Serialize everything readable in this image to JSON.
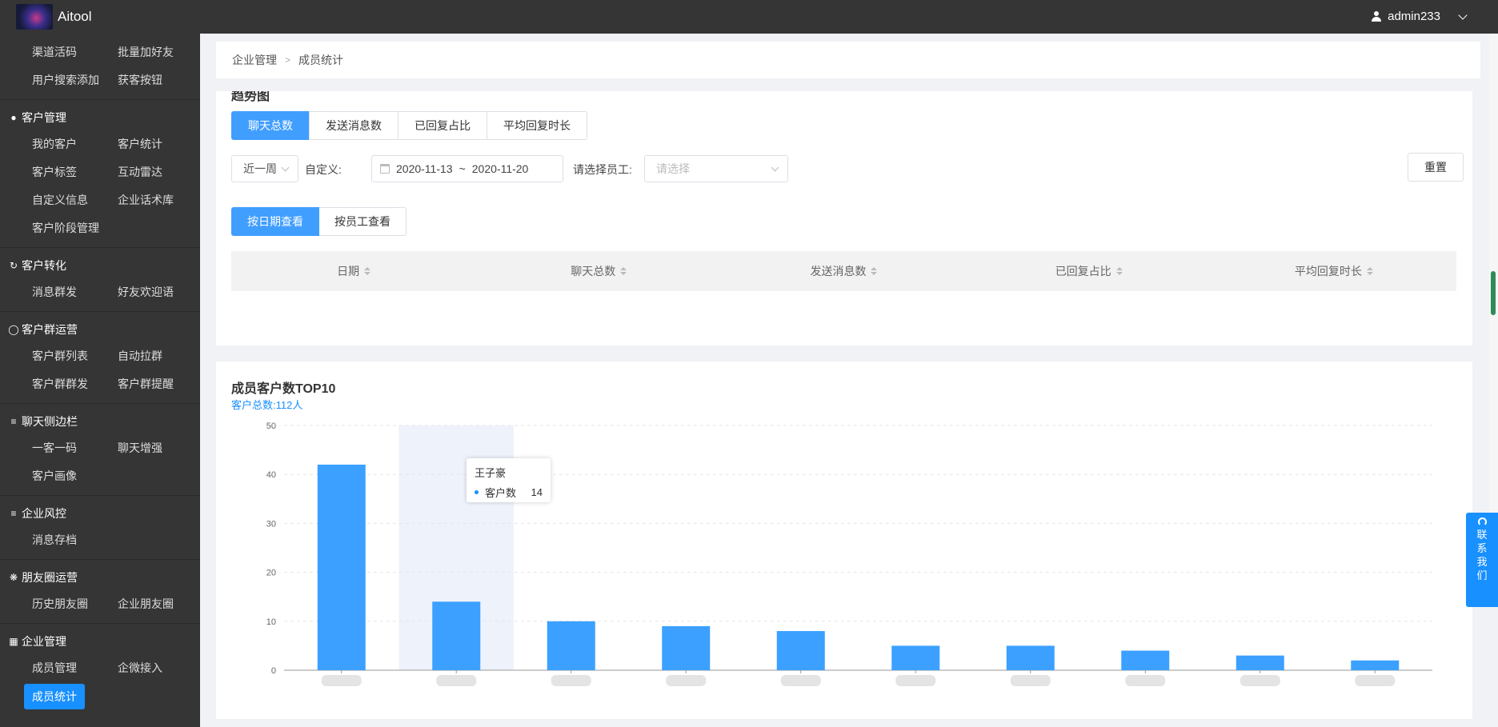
{
  "app": {
    "title": "Aitool",
    "user": "admin233"
  },
  "sidebar": {
    "top_items": [
      "渠道活码",
      "批量加好友",
      "用户搜索添加",
      "获客按钮"
    ],
    "groups": [
      {
        "title": "客户管理",
        "icon": "user-icon",
        "items": [
          "我的客户",
          "客户统计",
          "客户标签",
          "互动雷达",
          "自定义信息",
          "企业话术库",
          "客户阶段管理"
        ]
      },
      {
        "title": "客户转化",
        "icon": "refresh-icon",
        "items": [
          "消息群发",
          "好友欢迎语"
        ]
      },
      {
        "title": "客户群运营",
        "icon": "chat-icon",
        "items": [
          "客户群列表",
          "自动拉群",
          "客户群群发",
          "客户群提醒"
        ]
      },
      {
        "title": "聊天侧边栏",
        "icon": "menu-icon",
        "items": [
          "一客一码",
          "聊天增强",
          "客户画像"
        ]
      },
      {
        "title": "企业风控",
        "icon": "menu-icon",
        "items": [
          "消息存档"
        ]
      },
      {
        "title": "朋友圈运营",
        "icon": "moments-icon",
        "items": [
          "历史朋友圈",
          "企业朋友圈"
        ]
      },
      {
        "title": "企业管理",
        "icon": "building-icon",
        "items": [
          "成员管理",
          "企微接入",
          "成员统计"
        ]
      }
    ],
    "active_item": "成员统计"
  },
  "breadcrumb": [
    "企业管理",
    "成员统计"
  ],
  "trend": {
    "title": "趋势图",
    "tabs": [
      "聊天总数",
      "发送消息数",
      "已回复占比",
      "平均回复时长"
    ],
    "active_tab": "聊天总数",
    "range_select": "近一周",
    "custom_label": "自定义:",
    "date_start": "2020-11-13",
    "date_sep": "~",
    "date_end": "2020-11-20",
    "staff_label": "请选择员工:",
    "staff_placeholder": "请选择",
    "reset_label": "重置",
    "view_tabs": [
      "按日期查看",
      "按员工查看"
    ],
    "table_headers": [
      "日期",
      "聊天总数",
      "发送消息数",
      "已回复占比",
      "平均回复时长"
    ]
  },
  "top10": {
    "title": "成员客户数TOP10",
    "subtitle": "客户总数:112人",
    "tooltip": {
      "name": "王子豪",
      "series": "客户数",
      "value": "14"
    }
  },
  "chart_data": {
    "type": "bar",
    "title": "成员客户数TOP10",
    "categories": [
      "",
      "王子豪",
      "",
      "",
      "",
      "",
      "",
      "",
      "",
      ""
    ],
    "series": [
      {
        "name": "客户数",
        "values": [
          42,
          14,
          10,
          9,
          8,
          5,
          5,
          4,
          3,
          2
        ]
      }
    ],
    "ylim": [
      0,
      50
    ],
    "yticks": [
      0,
      10,
      20,
      30,
      40,
      50
    ],
    "grid": true,
    "highlight_index": 1,
    "color": "#3ba0ff"
  },
  "contact": {
    "label": "联系我们"
  }
}
